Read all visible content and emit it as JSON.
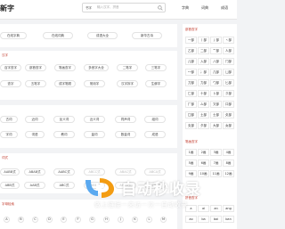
{
  "header": {
    "logo_text": "新字",
    "search": {
      "select_label": "书字",
      "placeholder": "输入汉字、拼音"
    },
    "nav": [
      "字典",
      "词典",
      "成语"
    ]
  },
  "row_top": [
    "在线字典",
    "在线词典",
    "成语大全",
    "新华古诗"
  ],
  "section_a": {
    "title": "汉字",
    "row1": [
      "百字查字",
      "部首查字",
      "笔画查字",
      "多音字大全",
      "二笔字",
      "三笔字"
    ],
    "row2": [
      "查字",
      "五笔字",
      "成字笔顺",
      "常用字",
      "汉字拆字",
      "生僻字"
    ]
  },
  "section_b": {
    "row1": [
      "古词",
      "近词",
      "反义词",
      "近义词",
      "同声词",
      "组词"
    ],
    "row2": [
      "字词",
      "词语",
      "教词",
      "量词",
      "数量词",
      "成语"
    ]
  },
  "section_c": {
    "title": "词式",
    "row1": [
      "AABB式",
      "ABAB式",
      "AABC式",
      "ABCC式",
      "ABAC式",
      "ABCA式"
    ],
    "row2": [
      "ABB式",
      "AAB式",
      "ABC式",
      "AABB式",
      "ABCD式",
      "ABBC式"
    ]
  },
  "section_d": {
    "title": "字母检索",
    "letters": [
      "A",
      "B",
      "C",
      "D",
      "E",
      "F",
      "G",
      "H",
      "J",
      "K",
      "L",
      "M"
    ]
  },
  "sidebar": {
    "title_1": "部首查字",
    "grid_1": [
      [
        "一部",
        "丨部",
        "丿部",
        "丶部"
      ],
      [
        "乙部",
        "二部",
        "亠部",
        "人部"
      ],
      [
        "儿部",
        "入部",
        "八部",
        "冂部"
      ],
      [
        "冖部",
        "冫部",
        "几部",
        "凵部"
      ],
      [
        "刀部",
        "力部",
        "勹部",
        "匕部"
      ],
      [
        "匚部",
        "十部",
        "卜部",
        "卩部"
      ],
      [
        "厂部",
        "厶部",
        "又部",
        "口部"
      ],
      [
        "囗部",
        "土部",
        "士部",
        "夂部"
      ],
      [
        "夊部",
        "夕部",
        "大部",
        "女部"
      ]
    ],
    "title_2": "笔画查字",
    "grid_2": [
      [
        "1画",
        "2画",
        "3画",
        "4画"
      ],
      [
        "5画",
        "6画",
        "7画",
        "8画"
      ],
      [
        "9画",
        "10画",
        "11画",
        "12画"
      ]
    ],
    "title_3": "拼音查字",
    "grid_3": [
      [
        "a",
        "ai",
        "an",
        "ang"
      ],
      [
        "ao",
        "ba",
        "bai",
        "ban"
      ]
    ]
  },
  "watermark": {
    "title": "自动秒收录",
    "subtitle": "做上链接一来访一次一自动收录"
  },
  "colors": {
    "accent": "#c0392b",
    "watermark_blue": "#5aa9f0",
    "watermark_orange": "#f39c12"
  }
}
